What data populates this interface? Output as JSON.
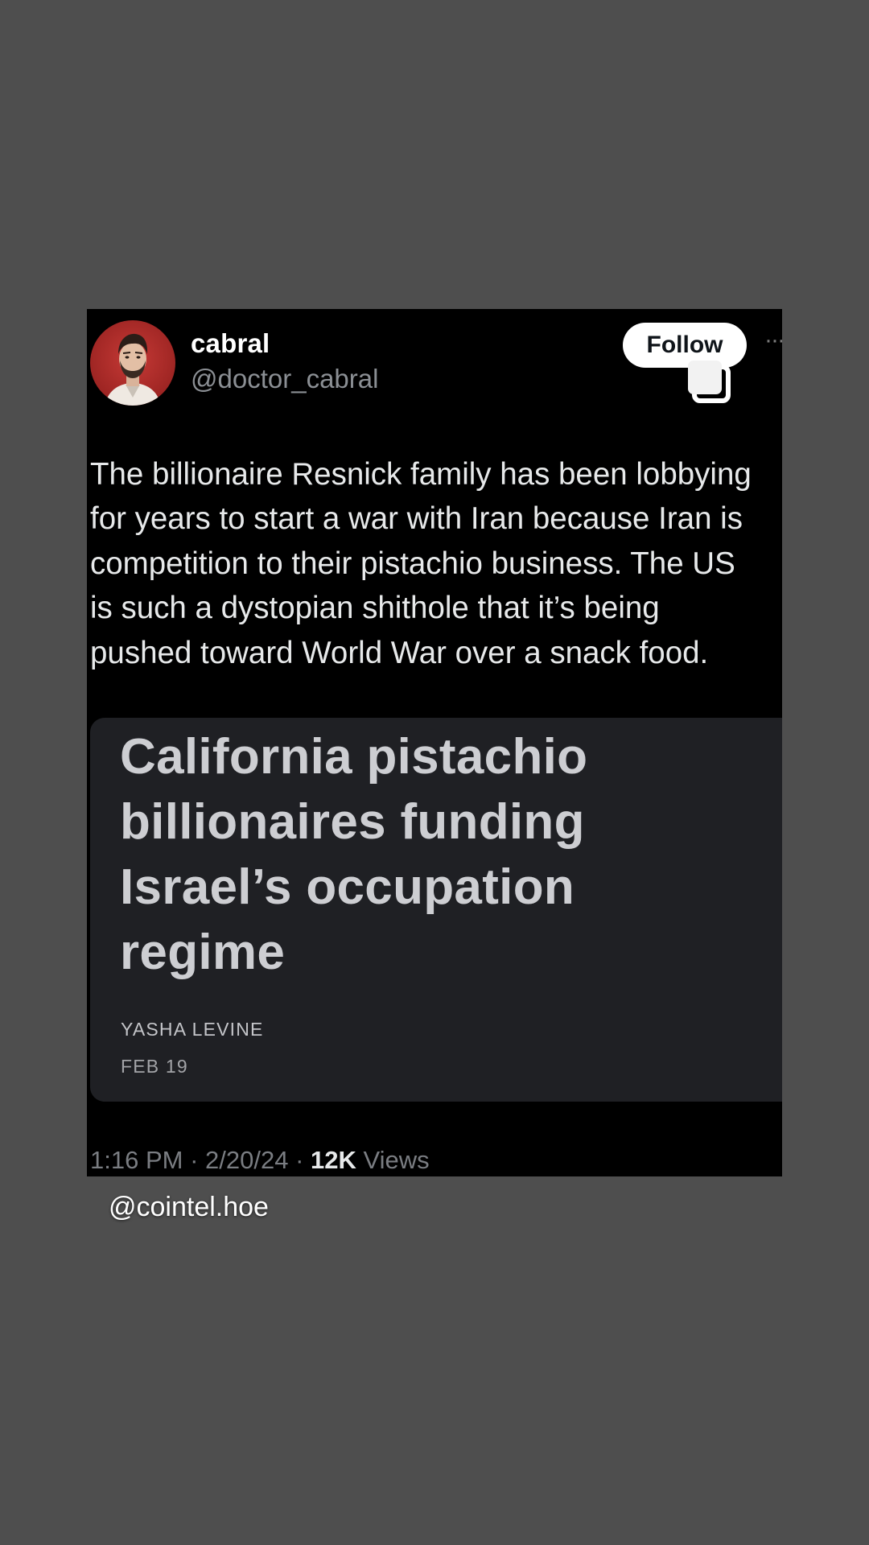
{
  "user": {
    "display_name": "cabral",
    "handle": "@doctor_cabral"
  },
  "follow_button": {
    "label": "Follow"
  },
  "tweet": {
    "lines": [
      "The billionaire Resnick family has been lobbying",
      "for years to start a war with Iran because Iran is",
      "competition to their pistachio business. The US",
      "is such a dystopian shithole that it’s being",
      "pushed toward World War over a snack food."
    ]
  },
  "card": {
    "headline_lines": [
      "California pistachio",
      "billionaires funding",
      "Israel’s occupation",
      "regime"
    ],
    "author": "YASHA LEVINE",
    "date": "FEB 19"
  },
  "meta": {
    "time": "1:16 PM",
    "sep1": " · ",
    "date": "2/20/24",
    "sep2": " · ",
    "views_count": "12K",
    "views_label": " Views"
  },
  "watermark": "@cointel.hoe",
  "colors": {
    "background": "#4e4e4e",
    "post_background": "#000000",
    "card_background": "#1f2024",
    "follow_button": "#ffffff",
    "avatar_red": "#b8302d"
  },
  "icons": {
    "avatar": "profile-photo",
    "copy": "copy-icon",
    "more": "more-options-icon"
  }
}
